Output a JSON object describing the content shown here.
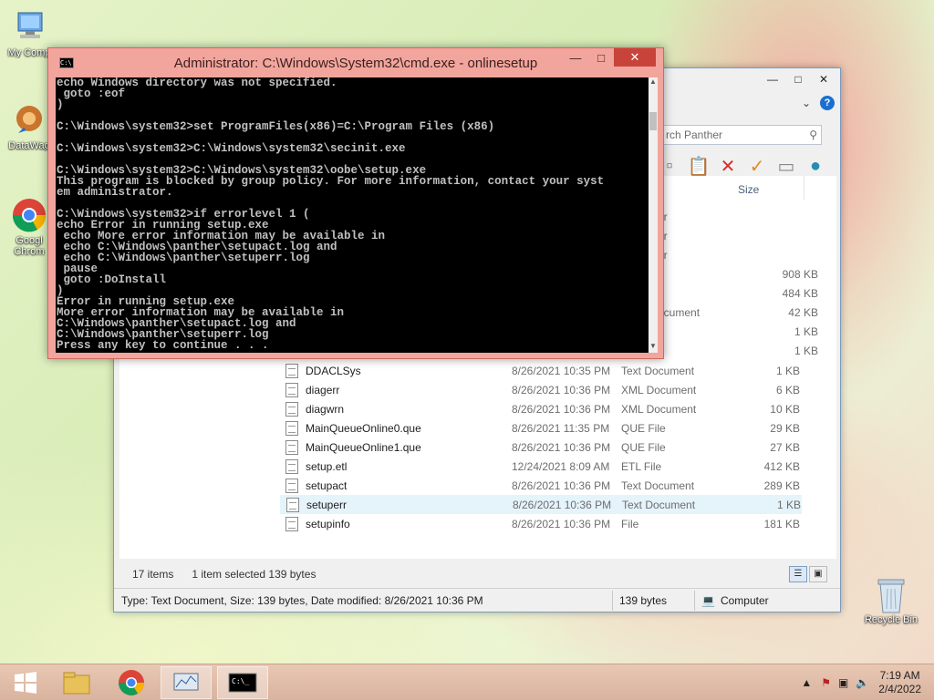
{
  "desktop": {
    "icons": [
      {
        "label": "My Comp"
      },
      {
        "label": "DataWag"
      },
      {
        "label": "Googl Chrom"
      }
    ],
    "recycle_bin": "Recycle Bin"
  },
  "cmd": {
    "title": "Administrator: C:\\Windows\\System32\\cmd.exe - onlinesetup",
    "lines": [
      "echo Windows directory was not specified.",
      " goto :eof",
      ")",
      "",
      "C:\\Windows\\system32>set ProgramFiles(x86)=C:\\Program Files (x86)",
      "",
      "C:\\Windows\\system32>C:\\Windows\\system32\\secinit.exe",
      "",
      "C:\\Windows\\system32>C:\\Windows\\system32\\oobe\\setup.exe",
      "This program is blocked by group policy. For more information, contact your syst",
      "em administrator.",
      "",
      "C:\\Windows\\system32>if errorlevel 1 (",
      "echo Error in running setup.exe",
      " echo More error information may be available in",
      " echo C:\\Windows\\panther\\setupact.log and",
      " echo C:\\Windows\\panther\\setuperr.log",
      " pause",
      " goto :DoInstall",
      ")",
      "Error in running setup.exe",
      "More error information may be available in",
      "C:\\Windows\\panther\\setupact.log and",
      "C:\\Windows\\panther\\setuperr.log",
      "Press any key to continue . . ."
    ]
  },
  "explorer": {
    "search_placeholder": "rch Panther",
    "column_size": "Size",
    "partial_rows": [
      {
        "type": "er",
        "size": ""
      },
      {
        "type": "er",
        "size": ""
      },
      {
        "type": "er",
        "size": ""
      },
      {
        "type": "e",
        "size": "908 KB"
      },
      {
        "type": "e",
        "size": "484 KB"
      },
      {
        "type": "ocument",
        "size": "42 KB"
      },
      {
        "type": "",
        "size": "1 KB"
      },
      {
        "type": "",
        "size": "1 KB"
      }
    ],
    "files": [
      {
        "name": "DDACLSys",
        "date": "8/26/2021 10:35 PM",
        "type": "Text Document",
        "size": "1 KB"
      },
      {
        "name": "diagerr",
        "date": "8/26/2021 10:36 PM",
        "type": "XML Document",
        "size": "6 KB"
      },
      {
        "name": "diagwrn",
        "date": "8/26/2021 10:36 PM",
        "type": "XML Document",
        "size": "10 KB"
      },
      {
        "name": "MainQueueOnline0.que",
        "date": "8/26/2021 11:35 PM",
        "type": "QUE File",
        "size": "29 KB"
      },
      {
        "name": "MainQueueOnline1.que",
        "date": "8/26/2021 10:36 PM",
        "type": "QUE File",
        "size": "27 KB"
      },
      {
        "name": "setup.etl",
        "date": "12/24/2021 8:09 AM",
        "type": "ETL File",
        "size": "412 KB"
      },
      {
        "name": "setupact",
        "date": "8/26/2021 10:36 PM",
        "type": "Text Document",
        "size": "289 KB"
      },
      {
        "name": "setuperr",
        "date": "8/26/2021 10:36 PM",
        "type": "Text Document",
        "size": "1 KB"
      },
      {
        "name": "setupinfo",
        "date": "8/26/2021 10:36 PM",
        "type": "File",
        "size": "181 KB"
      }
    ],
    "status_items": "17 items",
    "status_selected": "1 item selected  139 bytes",
    "bottom_info": "Type: Text Document, Size: 139 bytes, Date modified: 8/26/2021 10:36 PM",
    "bottom_size": "139 bytes",
    "bottom_location": "Computer"
  },
  "taskbar": {
    "time": "7:19 AM",
    "date": "2/4/2022"
  }
}
